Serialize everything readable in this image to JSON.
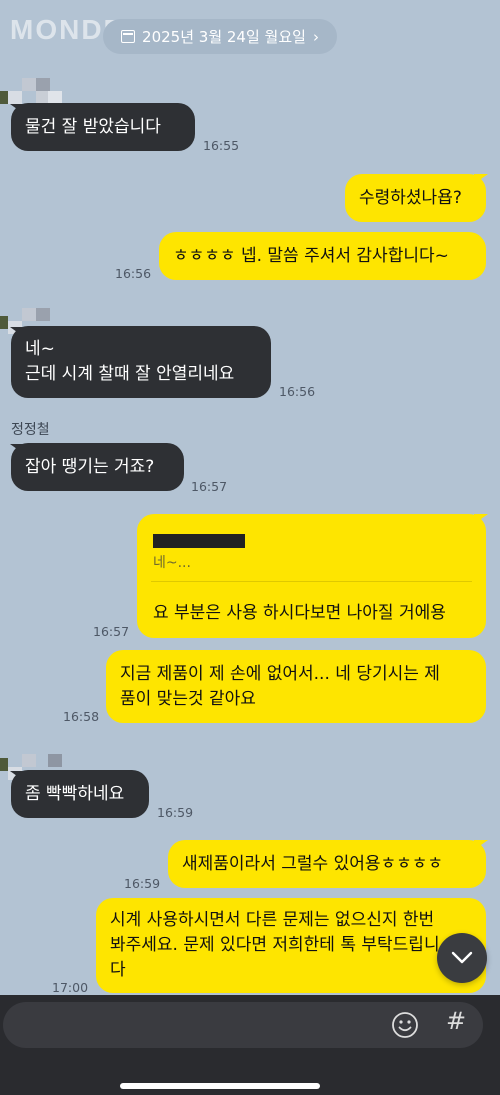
{
  "watermark": "MONDE",
  "date_pill": {
    "text": "2025년 3월 24일 월요일",
    "chevron": "›",
    "icon": "calendar-icon"
  },
  "sender_name": "정정철",
  "messages": [
    {
      "dir": "in",
      "text": "물건 잘 받았습니다",
      "time": "16:55"
    },
    {
      "dir": "out",
      "text": "수령하셨나욥?",
      "time": ""
    },
    {
      "dir": "out",
      "text": "ㅎㅎㅎㅎ 넵. 말씀 주셔서 감사합니다~",
      "time": "16:56"
    },
    {
      "dir": "in",
      "line1": "네~",
      "line2": "근데 시계 찰때 잘 안열리네요",
      "time": "16:56"
    },
    {
      "dir": "in",
      "text": "잡아 땡기는 거죠?",
      "time": "16:57"
    },
    {
      "dir": "out",
      "reply_quote": "네~...",
      "text": "요 부분은 사용 하시다보면 나아질 거에용",
      "time": "16:57"
    },
    {
      "dir": "out",
      "line1": "지금 제품이 제 손에 없어서... 네 당기시는 제",
      "line2": "품이 맞는것 같아요",
      "time": "16:58"
    },
    {
      "dir": "in",
      "text": "좀 빡빡하네요",
      "time": "16:59"
    },
    {
      "dir": "out",
      "text": "새제품이라서 그럴수 있어용ㅎㅎㅎㅎ",
      "time": "16:59"
    },
    {
      "dir": "out",
      "line1": "시계 사용하시면서 다른 문제는 없으신지 한번",
      "line2": "봐주세요. 문제 있다면 저희한테 톡 부탁드립니",
      "line3": "다",
      "time": "17:00"
    }
  ],
  "composer": {
    "emoji_icon": "emoji-icon",
    "hash_label": "#"
  },
  "colors": {
    "background": "#b3c3d3",
    "outgoing": "#fee500",
    "incoming": "#2e3034"
  }
}
